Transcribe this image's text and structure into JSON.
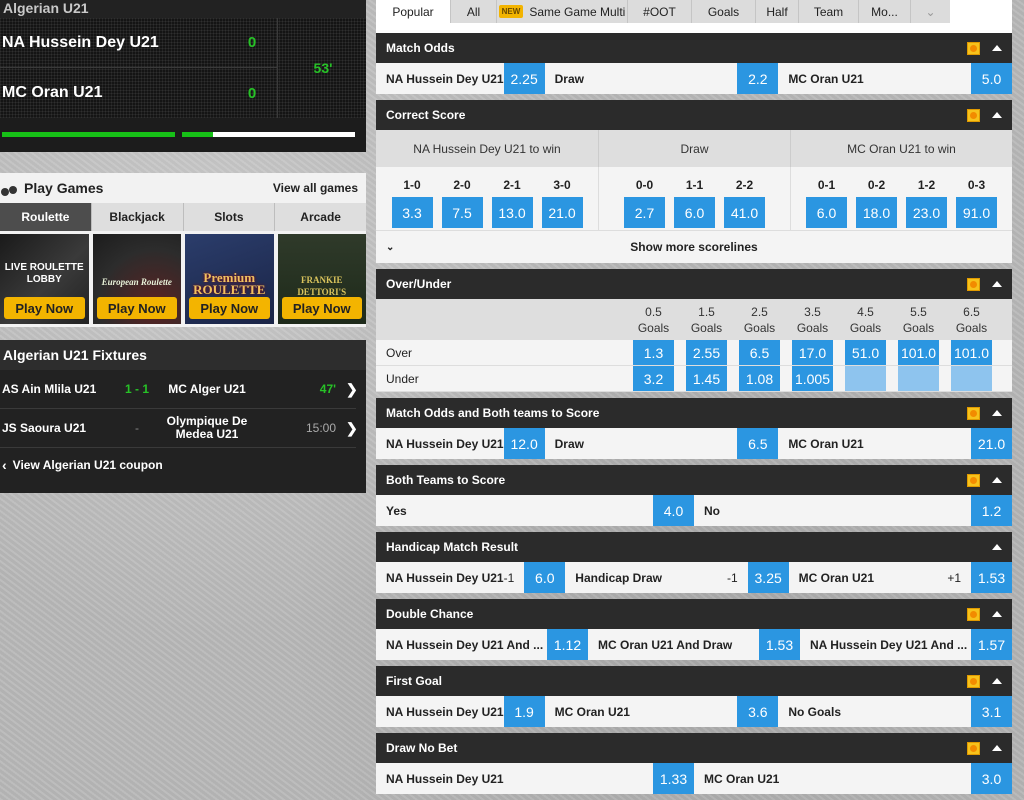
{
  "scoreboard": {
    "league": "Algerian U21",
    "home_team": "NA Hussein Dey U21",
    "away_team": "MC Oran U21",
    "home_score": "0",
    "away_score": "0",
    "match_time": "53'",
    "progress": {
      "first_half": 1.0,
      "second_half": 0.18
    }
  },
  "games": {
    "title": "Play Games",
    "view_all": "View all games",
    "tabs": [
      "Roulette",
      "Blackjack",
      "Slots",
      "Arcade"
    ],
    "active_tab": "Roulette",
    "tiles": [
      {
        "art": "LIVE ROULETTE LOBBY",
        "cta": "Play Now"
      },
      {
        "art": "European Roulette",
        "cta": "Play Now"
      },
      {
        "art": "Premium ROULETTE",
        "cta": "Play Now"
      },
      {
        "art": "FRANKIE DETTORI'S",
        "cta": "Play Now"
      }
    ]
  },
  "fixtures": {
    "title": "Algerian U21 Fixtures",
    "rows": [
      {
        "home": "AS Ain Mlila U21",
        "score": "1 - 1",
        "away": "MC Alger U21",
        "time": "47'"
      },
      {
        "home": "JS Saoura U21",
        "score": "-",
        "away": "Olympique De Medea U21",
        "time": "15:00"
      }
    ],
    "coupon_link": "View Algerian U21 coupon"
  },
  "market_tabs": [
    {
      "label": "Popular",
      "active": true
    },
    {
      "label": "All"
    },
    {
      "label": "Same Game Multi",
      "badge": "NEW"
    },
    {
      "label": "#OOT"
    },
    {
      "label": "Goals"
    },
    {
      "label": "Half"
    },
    {
      "label": "Team"
    },
    {
      "label": "Mo..."
    }
  ],
  "markets": {
    "match_odds": {
      "title": "Match Odds",
      "selections": [
        {
          "label": "NA Hussein Dey U21",
          "odds": "2.25"
        },
        {
          "label": "Draw",
          "odds": "2.2"
        },
        {
          "label": "MC Oran U21",
          "odds": "5.0"
        }
      ]
    },
    "correct_score": {
      "title": "Correct Score",
      "groups": [
        {
          "heading": "NA Hussein Dey U21 to win",
          "scores": [
            {
              "score": "1-0",
              "odds": "3.3"
            },
            {
              "score": "2-0",
              "odds": "7.5"
            },
            {
              "score": "2-1",
              "odds": "13.0"
            },
            {
              "score": "3-0",
              "odds": "21.0"
            }
          ]
        },
        {
          "heading": "Draw",
          "scores": [
            {
              "score": "0-0",
              "odds": "2.7"
            },
            {
              "score": "1-1",
              "odds": "6.0"
            },
            {
              "score": "2-2",
              "odds": "41.0"
            }
          ]
        },
        {
          "heading": "MC Oran U21 to win",
          "scores": [
            {
              "score": "0-1",
              "odds": "6.0"
            },
            {
              "score": "0-2",
              "odds": "18.0"
            },
            {
              "score": "1-2",
              "odds": "23.0"
            },
            {
              "score": "0-3",
              "odds": "91.0"
            }
          ]
        }
      ],
      "show_more": "Show more scorelines"
    },
    "over_under": {
      "title": "Over/Under",
      "lines": [
        {
          "line": "0.5",
          "unit": "Goals",
          "over": "1.3",
          "under": "3.2"
        },
        {
          "line": "1.5",
          "unit": "Goals",
          "over": "2.55",
          "under": "1.45"
        },
        {
          "line": "2.5",
          "unit": "Goals",
          "over": "6.5",
          "under": "1.08"
        },
        {
          "line": "3.5",
          "unit": "Goals",
          "over": "17.0",
          "under": "1.005"
        },
        {
          "line": "4.5",
          "unit": "Goals",
          "over": "51.0",
          "under": ""
        },
        {
          "line": "5.5",
          "unit": "Goals",
          "over": "101.0",
          "under": ""
        },
        {
          "line": "6.5",
          "unit": "Goals",
          "over": "101.0",
          "under": ""
        }
      ],
      "over_label": "Over",
      "under_label": "Under"
    },
    "mo_btts": {
      "title": "Match Odds and Both teams to Score",
      "selections": [
        {
          "label": "NA Hussein Dey U21",
          "odds": "12.0"
        },
        {
          "label": "Draw",
          "odds": "6.5"
        },
        {
          "label": "MC Oran U21",
          "odds": "21.0"
        }
      ]
    },
    "btts": {
      "title": "Both Teams to Score",
      "selections": [
        {
          "label": "Yes",
          "odds": "4.0"
        },
        {
          "label": "No",
          "odds": "1.2"
        }
      ]
    },
    "handicap": {
      "title": "Handicap Match Result",
      "selections": [
        {
          "label": "NA Hussein Dey U21",
          "hcp": "-1",
          "odds": "6.0"
        },
        {
          "label": "Handicap Draw",
          "hcp": "-1",
          "odds": "3.25"
        },
        {
          "label": "MC Oran U21",
          "hcp": "+1",
          "odds": "1.53"
        }
      ]
    },
    "double_chance": {
      "title": "Double Chance",
      "selections": [
        {
          "label": "NA Hussein Dey U21 And ...",
          "odds": "1.12"
        },
        {
          "label": "MC Oran U21 And Draw",
          "odds": "1.53"
        },
        {
          "label": "NA Hussein Dey U21 And ...",
          "odds": "1.57"
        }
      ]
    },
    "first_goal": {
      "title": "First Goal",
      "selections": [
        {
          "label": "NA Hussein Dey U21",
          "odds": "1.9"
        },
        {
          "label": "MC Oran U21",
          "odds": "3.6"
        },
        {
          "label": "No Goals",
          "odds": "3.1"
        }
      ]
    },
    "draw_no_bet": {
      "title": "Draw No Bet",
      "selections": [
        {
          "label": "NA Hussein Dey U21",
          "odds": "1.33"
        },
        {
          "label": "MC Oran U21",
          "odds": "3.0"
        }
      ]
    }
  }
}
